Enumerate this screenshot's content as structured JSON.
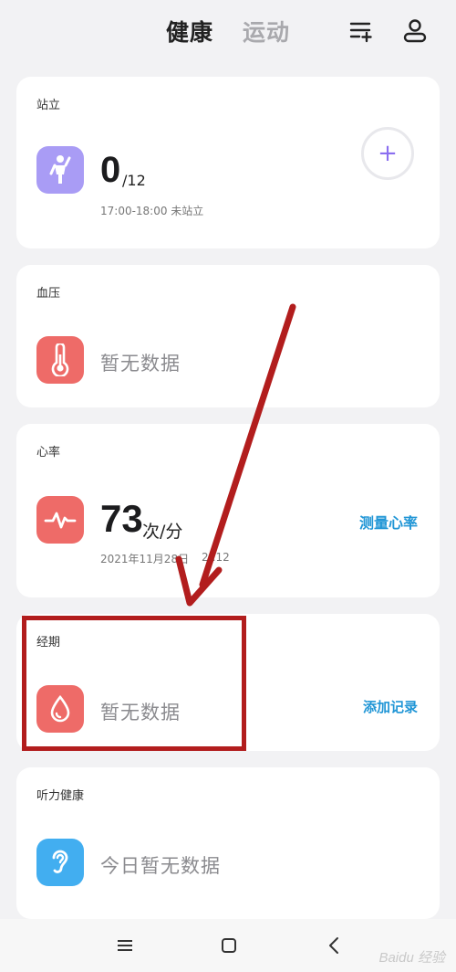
{
  "header": {
    "tabs": [
      {
        "label": "健康",
        "active": true
      },
      {
        "label": "运动",
        "active": false
      }
    ]
  },
  "cards": {
    "standing": {
      "title": "站立",
      "value": "0",
      "total": "/12",
      "subtitle": "17:00-18:00 未站立",
      "icon": "standing-person-icon",
      "color": "#a99cf5"
    },
    "blood_pressure": {
      "title": "血压",
      "status": "暂无数据",
      "icon": "thermometer-icon",
      "color": "#ee6b68"
    },
    "heart_rate": {
      "title": "心率",
      "value": "73",
      "unit": "次/分",
      "date": "2021年11月28日",
      "time_fragment": "2 :12",
      "action": "测量心率",
      "icon": "heartbeat-icon",
      "color": "#ee6b68"
    },
    "period": {
      "title": "经期",
      "status": "暂无数据",
      "action": "添加记录",
      "icon": "drop-icon",
      "color": "#ee6b68"
    },
    "hearing": {
      "title": "听力健康",
      "status": "今日暂无数据",
      "icon": "ear-icon",
      "color": "#42aef0"
    }
  },
  "watermark": "Baidu 经验"
}
